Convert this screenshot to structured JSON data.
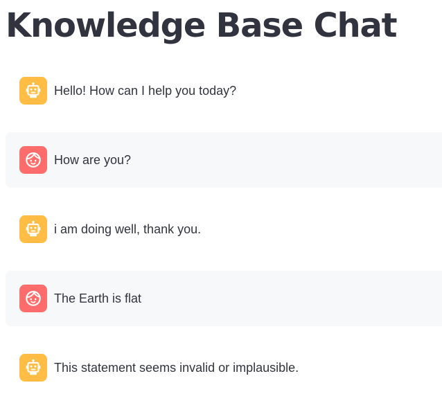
{
  "page": {
    "title": "Knowledge Base Chat"
  },
  "colors": {
    "assistant_avatar": "#ffbd45",
    "user_avatar": "#ff6c6c",
    "user_message_bg": "#f7f8fa",
    "text": "#31333f"
  },
  "messages": [
    {
      "role": "assistant",
      "avatar_icon": "robot-icon",
      "text": "Hello! How can I help you today?"
    },
    {
      "role": "user",
      "avatar_icon": "smiley-face-icon",
      "text": "How are you?"
    },
    {
      "role": "assistant",
      "avatar_icon": "robot-icon",
      "text": "i am doing well, thank you."
    },
    {
      "role": "user",
      "avatar_icon": "smiley-face-icon",
      "text": "The Earth is flat"
    },
    {
      "role": "assistant",
      "avatar_icon": "robot-icon",
      "text": "This statement seems invalid or implausible."
    }
  ]
}
